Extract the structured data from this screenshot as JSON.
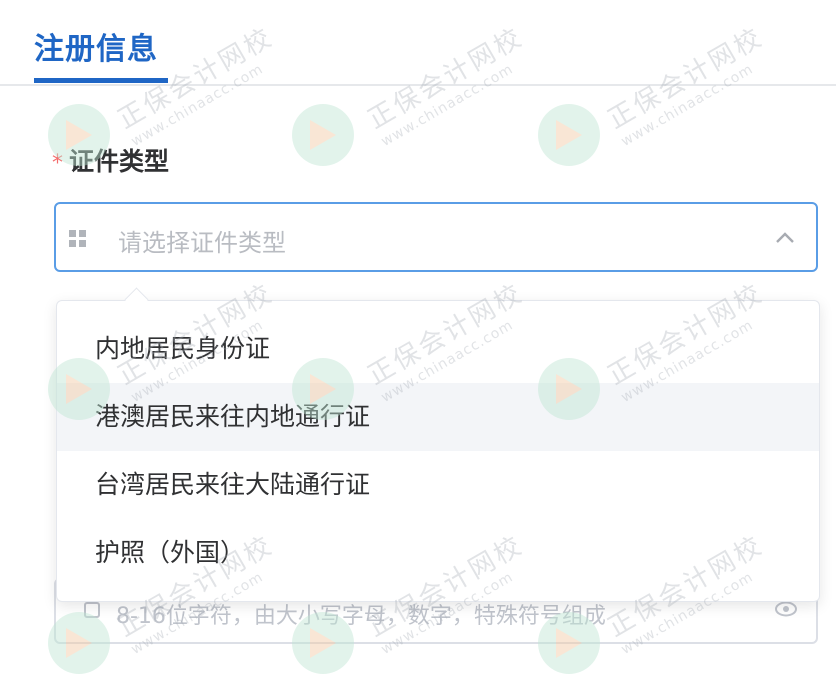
{
  "tabs": {
    "active_label": "注册信息"
  },
  "form": {
    "id_type": {
      "required_mark": "*",
      "label": "证件类型",
      "placeholder": "请选择证件类型",
      "options": [
        "内地居民身份证",
        "港澳居民来往内地通行证",
        "台湾居民来往大陆通行证",
        "护照（外国）"
      ],
      "hovered_index": 1
    },
    "password": {
      "placeholder": "8-16位字符，由大小写字母，数字，特殊符号组成"
    }
  },
  "watermark": {
    "text_cn": "正保会计网校",
    "text_en": "www.chinaacc.com"
  },
  "colors": {
    "accent": "#1f66c5",
    "required": "#f56c6c",
    "focus_border": "#5a9de6"
  },
  "icons": {
    "select_prefix": "grid-icon",
    "select_suffix": "chevron-up-icon",
    "password_prefix": "lock-icon",
    "password_suffix": "eye-icon"
  }
}
